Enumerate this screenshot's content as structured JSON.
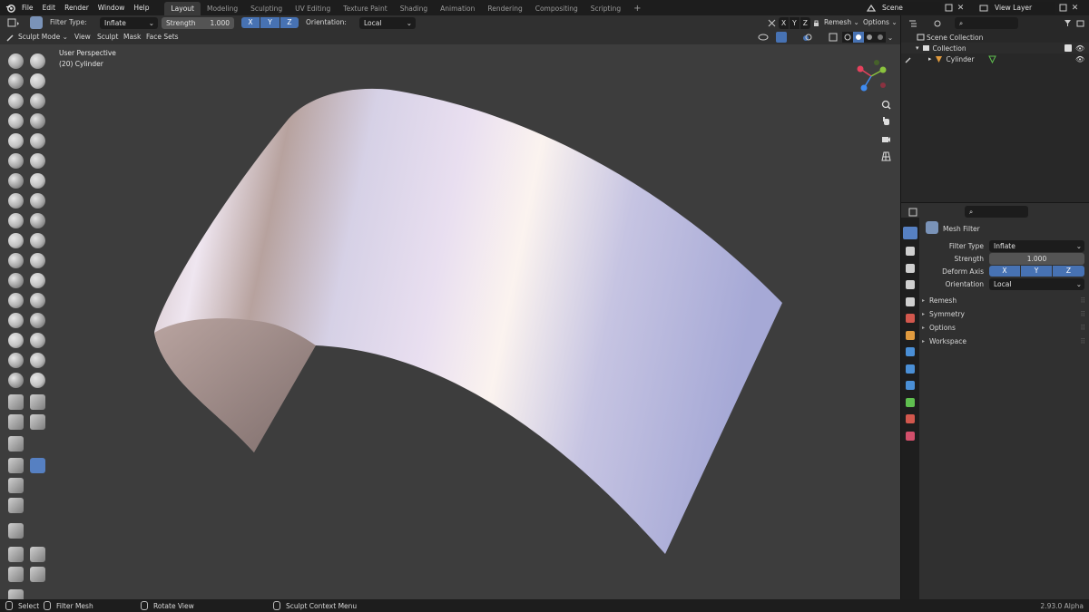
{
  "menu": {
    "items": [
      "File",
      "Edit",
      "Render",
      "Window",
      "Help"
    ]
  },
  "workspaces": {
    "tabs": [
      "Layout",
      "Modeling",
      "Sculpting",
      "UV Editing",
      "Texture Paint",
      "Shading",
      "Animation",
      "Rendering",
      "Compositing",
      "Scripting"
    ],
    "active_index": 0,
    "add_label": "+"
  },
  "scene": {
    "name": "Scene",
    "view_layer": "View Layer"
  },
  "tool_header": {
    "filter_type_label": "Filter Type:",
    "filter_type_value": "Inflate",
    "strength_label": "Strength",
    "strength_value": "1.000",
    "axes": [
      "X",
      "Y",
      "Z"
    ],
    "orientation_label": "Orientation:",
    "orientation_value": "Local",
    "sym_axes": [
      "X",
      "Y",
      "Z"
    ],
    "remesh_label": "Remesh",
    "options_label": "Options"
  },
  "mode_header": {
    "mode": "Sculpt Mode",
    "menus": [
      "View",
      "Sculpt",
      "Mask",
      "Face Sets"
    ]
  },
  "viewport": {
    "perspective": "User Perspective",
    "object": "(20) Cylinder"
  },
  "outliner": {
    "root": "Scene Collection",
    "collection": "Collection",
    "object": "Cylinder"
  },
  "properties": {
    "panel_title": "Mesh Filter",
    "filter_type_label": "Filter Type",
    "filter_type_value": "Inflate",
    "strength_label": "Strength",
    "strength_value": "1.000",
    "deform_axis_label": "Deform Axis",
    "axes": [
      "X",
      "Y",
      "Z"
    ],
    "orientation_label": "Orientation",
    "orientation_value": "Local",
    "sections": [
      "Remesh",
      "Symmetry",
      "Options",
      "Workspace"
    ]
  },
  "status": {
    "select": "Select",
    "filter": "Filter Mesh",
    "rotate": "Rotate View",
    "context": "Sculpt Context Menu",
    "version": "2.93.0 Alpha"
  },
  "colors": {
    "accent": "#4772b3",
    "axis_x": "#e6415d",
    "axis_y": "#8bc33e",
    "axis_z": "#3f8bf0"
  },
  "icons": {
    "blender_logo": "blender-icon",
    "tool_icons": "sculpt-brush-icon"
  }
}
